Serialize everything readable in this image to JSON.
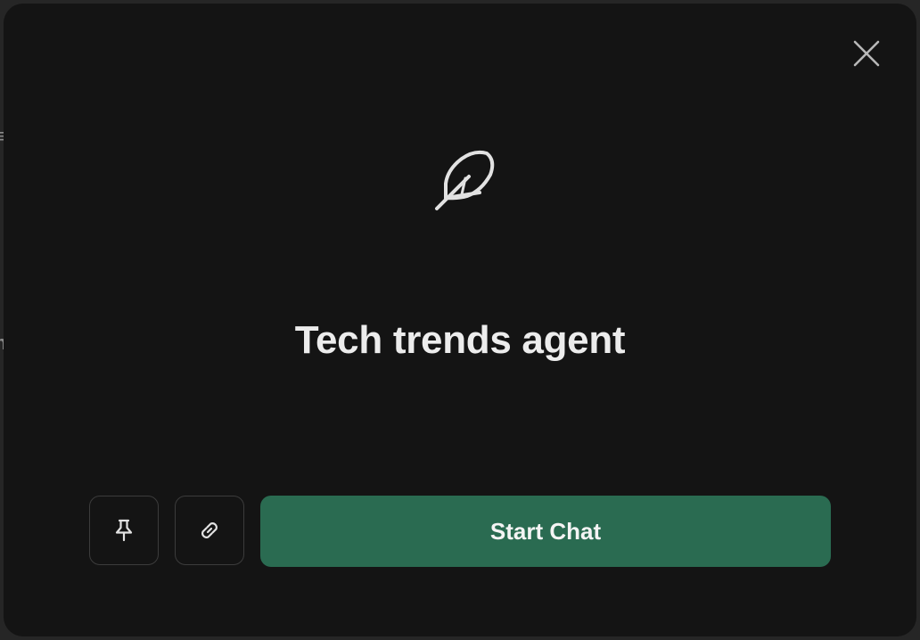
{
  "background": {
    "fragments": [
      "≡",
      "n"
    ]
  },
  "modal": {
    "close_icon": "close-icon",
    "agent_icon": "feather-icon",
    "title": "Tech trends agent",
    "actions": {
      "pin_icon": "pin-icon",
      "link_icon": "link-icon",
      "start_label": "Start Chat"
    }
  },
  "colors": {
    "modal_background": "#141414",
    "primary_button": "#2a6b51",
    "title_text": "#ececec",
    "button_border": "#3c3c3c"
  }
}
